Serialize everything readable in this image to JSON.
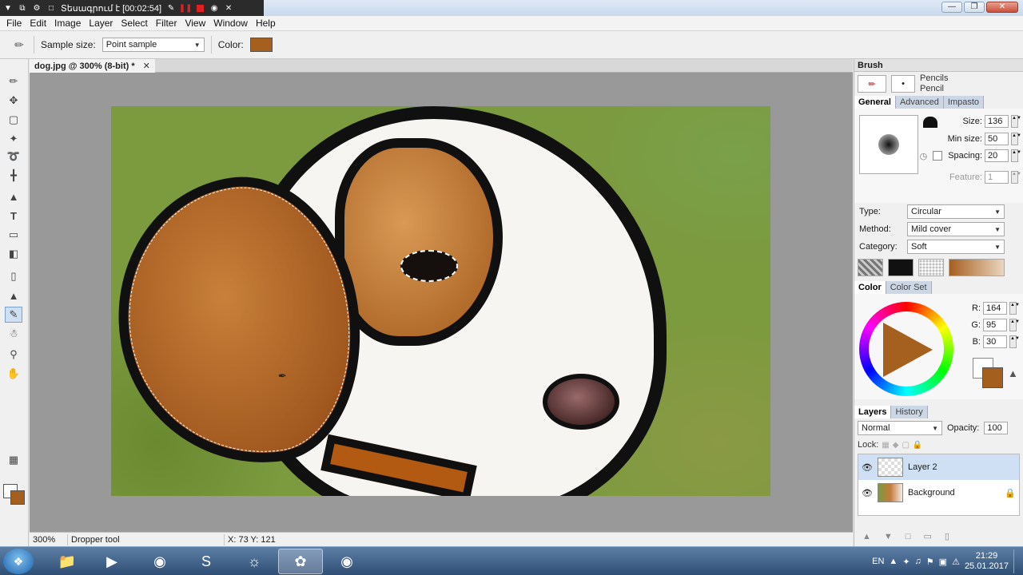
{
  "recorder": {
    "status": "Տեսագրում է [00:02:54]"
  },
  "menu": [
    "File",
    "Edit",
    "Image",
    "Layer",
    "Select",
    "Filter",
    "View",
    "Window",
    "Help"
  ],
  "options": {
    "sample_size_label": "Sample size:",
    "sample_size_value": "Point sample",
    "color_label": "Color:",
    "color_value": "#a55f1f"
  },
  "document": {
    "tab_title": "dog.jpg @ 300% (8-bit) *"
  },
  "status": {
    "zoom": "300%",
    "tool": "Dropper tool",
    "coords": "X: 73  Y: 121"
  },
  "brush": {
    "title": "Brush",
    "category": "Pencils",
    "name": "Pencil",
    "tabs": [
      "General",
      "Advanced",
      "Impasto"
    ],
    "size_label": "Size:",
    "size": "136",
    "min_size_label": "Min size:",
    "min_size": "50",
    "spacing_label": "Spacing:",
    "spacing": "20",
    "feature_label": "Feature:",
    "feature": "1",
    "type_label": "Type:",
    "type": "Circular",
    "method_label": "Method:",
    "method": "Mild cover",
    "category_label": "Category:",
    "category_value": "Soft"
  },
  "color_panel": {
    "tabs": [
      "Color",
      "Color Set"
    ],
    "r_label": "R:",
    "r": "164",
    "g_label": "G:",
    "g": "95",
    "b_label": "B:",
    "b": "30",
    "foreground": "#a45f1e"
  },
  "layers": {
    "tabs": [
      "Layers",
      "History"
    ],
    "blend": "Normal",
    "opacity_label": "Opacity:",
    "opacity": "100",
    "lock_label": "Lock:",
    "items": [
      {
        "name": "Layer 2",
        "selected": true
      },
      {
        "name": "Background",
        "selected": false
      }
    ]
  },
  "tray": {
    "lang": "EN",
    "time": "21:29",
    "date": "25.01.2017"
  }
}
